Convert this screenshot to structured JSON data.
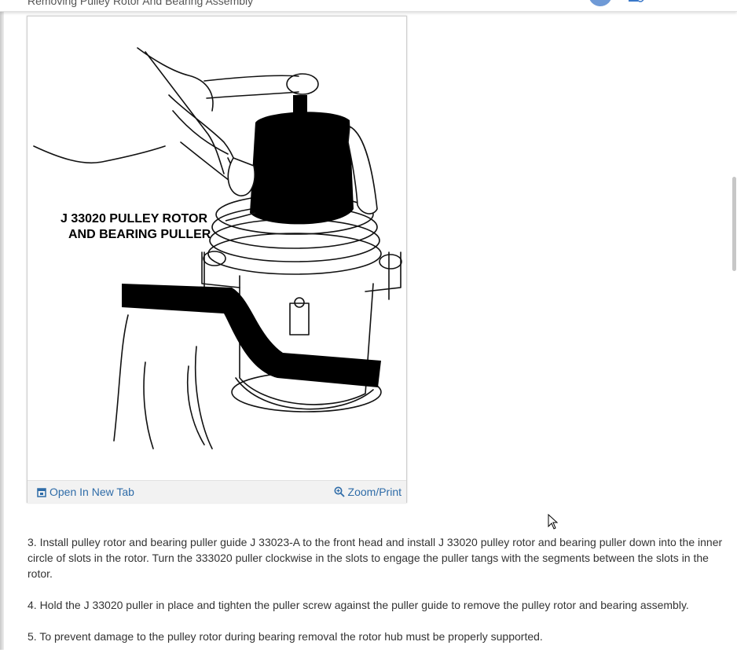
{
  "header": {
    "figure_title": "Removing Pulley Rotor And Bearing Assembly"
  },
  "figure": {
    "callout_line1": "J 33020 PULLEY ROTOR",
    "callout_line2": "AND BEARING PULLER",
    "open_tab_label": "Open In New Tab",
    "zoom_label": "Zoom/Print",
    "open_tab_icon": "open-in-new-tab-icon",
    "zoom_icon": "magnifier-zoom-icon"
  },
  "steps": [
    {
      "text": " 3. Install pulley rotor and bearing puller guide J 33023-A to the front head and install J 33020 pulley rotor and bearing puller down into the inner circle of slots in the rotor. Turn the 333020 puller clockwise in the slots to engage the puller tangs with the segments between the slots in the rotor."
    },
    {
      "text": " 4. Hold the J 33020 puller in place and tighten the puller screw against the puller guide to remove the pulley rotor and bearing assembly."
    },
    {
      "text": " 5. To prevent damage to the pulley rotor during bearing removal the rotor hub must be properly supported."
    }
  ],
  "colors": {
    "link": "#2f6ca8",
    "text": "#333333",
    "footer_bg": "#f2f2f2",
    "avatar": "#6f9ad6"
  }
}
